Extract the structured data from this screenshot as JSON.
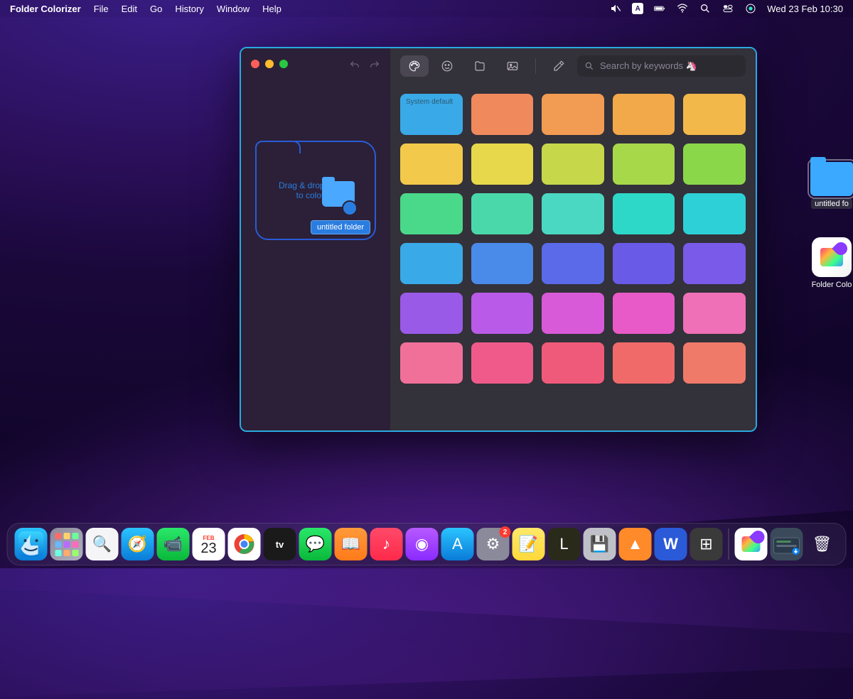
{
  "menubar": {
    "app_name": "Folder Colorizer",
    "items": [
      "File",
      "Edit",
      "Go",
      "History",
      "Window",
      "Help"
    ],
    "input_indicator": "A",
    "date_time": "Wed 23 Feb  10:30"
  },
  "window": {
    "traffic_colors": {
      "close": "#ff5f57",
      "min": "#febc2e",
      "max": "#28c840"
    },
    "dropzone": {
      "line1": "Drag & drop folders",
      "line2": "to colorize",
      "dragged_label": "untitled folder"
    },
    "search": {
      "placeholder": "Search by keywords 🦄"
    },
    "swatches": [
      {
        "label": "System default",
        "color": "#3aa9e8"
      },
      {
        "label": "",
        "color": "#f08a5d"
      },
      {
        "label": "",
        "color": "#f29b52"
      },
      {
        "label": "",
        "color": "#f2a94a"
      },
      {
        "label": "",
        "color": "#f2b84a"
      },
      {
        "label": "",
        "color": "#f2c94a"
      },
      {
        "label": "",
        "color": "#e6d84a"
      },
      {
        "label": "",
        "color": "#c6d84a"
      },
      {
        "label": "",
        "color": "#a6d84a"
      },
      {
        "label": "",
        "color": "#8ad84a"
      },
      {
        "label": "",
        "color": "#4ad88a"
      },
      {
        "label": "",
        "color": "#4ad8aa"
      },
      {
        "label": "",
        "color": "#4ad8c2"
      },
      {
        "label": "",
        "color": "#2ed8c8"
      },
      {
        "label": "",
        "color": "#2ed0d8"
      },
      {
        "label": "",
        "color": "#3aa9e8"
      },
      {
        "label": "",
        "color": "#4a8ae8"
      },
      {
        "label": "",
        "color": "#5a6ae8"
      },
      {
        "label": "",
        "color": "#6a5ae8"
      },
      {
        "label": "",
        "color": "#7a5ae8"
      },
      {
        "label": "",
        "color": "#9a5ae8"
      },
      {
        "label": "",
        "color": "#ba5ae8"
      },
      {
        "label": "",
        "color": "#d85ad8"
      },
      {
        "label": "",
        "color": "#e85ac8"
      },
      {
        "label": "",
        "color": "#f070b8"
      },
      {
        "label": "",
        "color": "#f0709a"
      },
      {
        "label": "",
        "color": "#f05a8a"
      },
      {
        "label": "",
        "color": "#f05a7a"
      },
      {
        "label": "",
        "color": "#f06a6a"
      },
      {
        "label": "",
        "color": "#f07a6a"
      }
    ]
  },
  "desktop": {
    "folder_label": "untitled fo",
    "app_label": "Folder Colo"
  },
  "dock": {
    "items": [
      {
        "name": "finder",
        "bg": "linear-gradient(180deg,#2ac4ff,#0a7bd8)",
        "glyph": ""
      },
      {
        "name": "launchpad",
        "bg": "linear-gradient(135deg,#8a8a9a,#b0b0c0)",
        "glyph": ""
      },
      {
        "name": "spotlight",
        "bg": "#f5f5f7",
        "glyph": "🔍"
      },
      {
        "name": "safari",
        "bg": "linear-gradient(180deg,#2ac4ff,#0a7bd8)",
        "glyph": "🧭"
      },
      {
        "name": "facetime",
        "bg": "linear-gradient(180deg,#2ae86a,#0ab83a)",
        "glyph": "📹"
      },
      {
        "name": "calendar",
        "bg": "#fff",
        "glyph": "",
        "badge": ""
      },
      {
        "name": "chrome",
        "bg": "#fff",
        "glyph": ""
      },
      {
        "name": "appletv",
        "bg": "#1a1a1a",
        "glyph": "tv"
      },
      {
        "name": "messages",
        "bg": "linear-gradient(180deg,#2ae86a,#0ab83a)",
        "glyph": "💬"
      },
      {
        "name": "books",
        "bg": "linear-gradient(180deg,#ff9a3a,#ff7a1a)",
        "glyph": "📖"
      },
      {
        "name": "music",
        "bg": "linear-gradient(180deg,#ff4a6a,#ff2a4a)",
        "glyph": "♪"
      },
      {
        "name": "podcasts",
        "bg": "linear-gradient(180deg,#b85aff,#8a2aff)",
        "glyph": "◉"
      },
      {
        "name": "appstore",
        "bg": "linear-gradient(180deg,#2ac4ff,#0a7bd8)",
        "glyph": "A"
      },
      {
        "name": "settings",
        "bg": "#8a8a9a",
        "glyph": "⚙",
        "badge": "2"
      },
      {
        "name": "notes",
        "bg": "linear-gradient(180deg,#ffe86a,#ffd83a)",
        "glyph": "📝"
      },
      {
        "name": "lol",
        "bg": "#2a2a1a",
        "glyph": "L"
      },
      {
        "name": "disk-util",
        "bg": "#c0c0c8",
        "glyph": "💾"
      },
      {
        "name": "vlc",
        "bg": "#ff8a2a",
        "glyph": "▲"
      },
      {
        "name": "word",
        "bg": "#2a5ad8",
        "glyph": "W"
      },
      {
        "name": "calculator",
        "bg": "#3a3a3a",
        "glyph": "⊞"
      }
    ],
    "right_items": [
      {
        "name": "folder-colorizer-dock",
        "bg": "#fff",
        "glyph": ""
      },
      {
        "name": "downloads",
        "bg": "#3a4a5a",
        "glyph": ""
      },
      {
        "name": "trash",
        "bg": "transparent",
        "glyph": "🗑"
      }
    ],
    "calendar": {
      "month": "FEB",
      "day": "23"
    }
  }
}
